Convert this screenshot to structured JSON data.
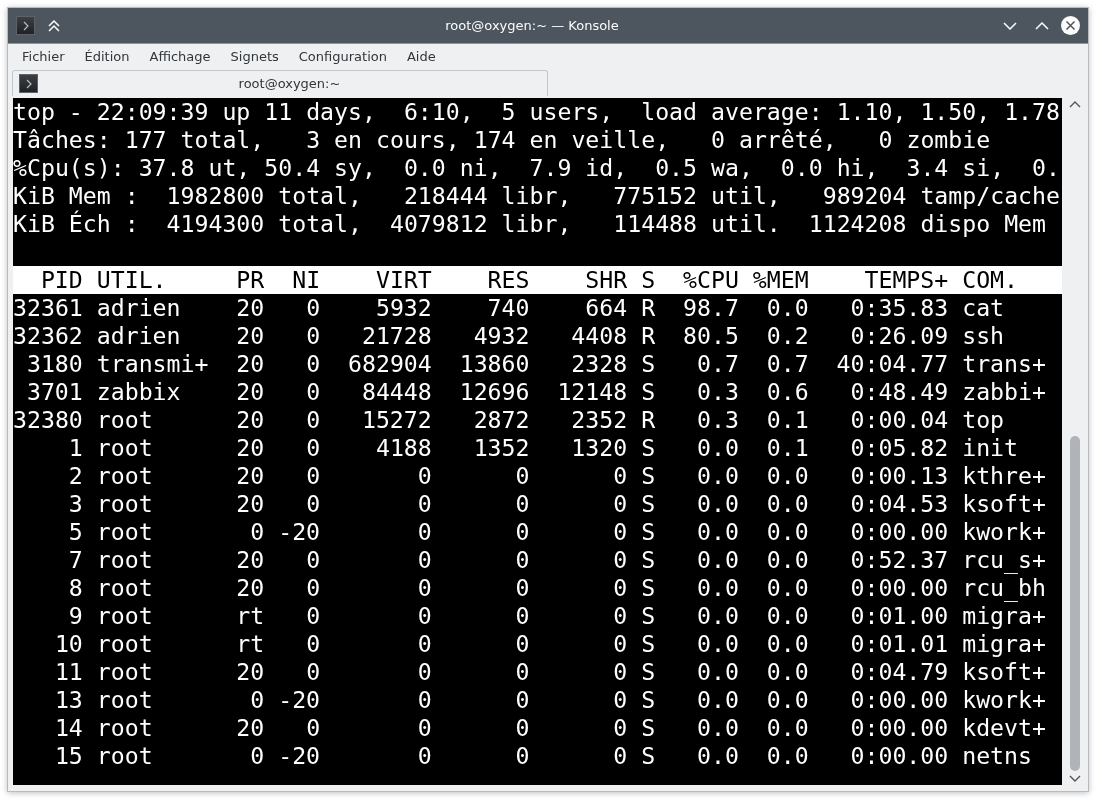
{
  "window": {
    "title": "root@oxygen:~ — Konsole"
  },
  "menu": [
    "Fichier",
    "Édition",
    "Affichage",
    "Signets",
    "Configuration",
    "Aide"
  ],
  "tabs": [
    {
      "label": "root@oxygen:~",
      "selected": true
    }
  ],
  "terminal": {
    "summary_lines": [
      "top - 22:09:39 up 11 days,  6:10,  5 users,  load average: 1.10, 1.50, 1.78",
      "Tâches: 177 total,   3 en cours, 174 en veille,   0 arrêté,   0 zombie",
      "%Cpu(s): 37.8 ut, 50.4 sy,  0.0 ni,  7.9 id,  0.5 wa,  0.0 hi,  3.4 si,  0.",
      "KiB Mem :  1982800 total,   218444 libr,   775152 util,   989204 tamp/cache",
      "KiB Éch :  4194300 total,  4079812 libr,   114488 util.  1124208 dispo Mem"
    ],
    "columns": [
      "PID",
      "UTIL.",
      "PR",
      "NI",
      "VIRT",
      "RES",
      "SHR",
      "S",
      "%CPU",
      "%MEM",
      "TEMPS+",
      "COM."
    ],
    "rows": [
      [
        "32361",
        "adrien",
        "20",
        "0",
        "5932",
        "740",
        "664",
        "R",
        "98.7",
        "0.0",
        "0:35.83",
        "cat"
      ],
      [
        "32362",
        "adrien",
        "20",
        "0",
        "21728",
        "4932",
        "4408",
        "R",
        "80.5",
        "0.2",
        "0:26.09",
        "ssh"
      ],
      [
        "3180",
        "transmi+",
        "20",
        "0",
        "682904",
        "13860",
        "2328",
        "S",
        "0.7",
        "0.7",
        "40:04.77",
        "trans+"
      ],
      [
        "3701",
        "zabbix",
        "20",
        "0",
        "84448",
        "12696",
        "12148",
        "S",
        "0.3",
        "0.6",
        "0:48.49",
        "zabbi+"
      ],
      [
        "32380",
        "root",
        "20",
        "0",
        "15272",
        "2872",
        "2352",
        "R",
        "0.3",
        "0.1",
        "0:00.04",
        "top"
      ],
      [
        "1",
        "root",
        "20",
        "0",
        "4188",
        "1352",
        "1320",
        "S",
        "0.0",
        "0.1",
        "0:05.82",
        "init"
      ],
      [
        "2",
        "root",
        "20",
        "0",
        "0",
        "0",
        "0",
        "S",
        "0.0",
        "0.0",
        "0:00.13",
        "kthre+"
      ],
      [
        "3",
        "root",
        "20",
        "0",
        "0",
        "0",
        "0",
        "S",
        "0.0",
        "0.0",
        "0:04.53",
        "ksoft+"
      ],
      [
        "5",
        "root",
        "0",
        "-20",
        "0",
        "0",
        "0",
        "S",
        "0.0",
        "0.0",
        "0:00.00",
        "kwork+"
      ],
      [
        "7",
        "root",
        "20",
        "0",
        "0",
        "0",
        "0",
        "S",
        "0.0",
        "0.0",
        "0:52.37",
        "rcu_s+"
      ],
      [
        "8",
        "root",
        "20",
        "0",
        "0",
        "0",
        "0",
        "S",
        "0.0",
        "0.0",
        "0:00.00",
        "rcu_bh"
      ],
      [
        "9",
        "root",
        "rt",
        "0",
        "0",
        "0",
        "0",
        "S",
        "0.0",
        "0.0",
        "0:01.00",
        "migra+"
      ],
      [
        "10",
        "root",
        "rt",
        "0",
        "0",
        "0",
        "0",
        "S",
        "0.0",
        "0.0",
        "0:01.01",
        "migra+"
      ],
      [
        "11",
        "root",
        "20",
        "0",
        "0",
        "0",
        "0",
        "S",
        "0.0",
        "0.0",
        "0:04.79",
        "ksoft+"
      ],
      [
        "13",
        "root",
        "0",
        "-20",
        "0",
        "0",
        "0",
        "S",
        "0.0",
        "0.0",
        "0:00.00",
        "kwork+"
      ],
      [
        "14",
        "root",
        "20",
        "0",
        "0",
        "0",
        "0",
        "S",
        "0.0",
        "0.0",
        "0:00.00",
        "kdevt+"
      ],
      [
        "15",
        "root",
        "0",
        "-20",
        "0",
        "0",
        "0",
        "S",
        "0.0",
        "0.0",
        "0:00.00",
        "netns"
      ]
    ]
  }
}
